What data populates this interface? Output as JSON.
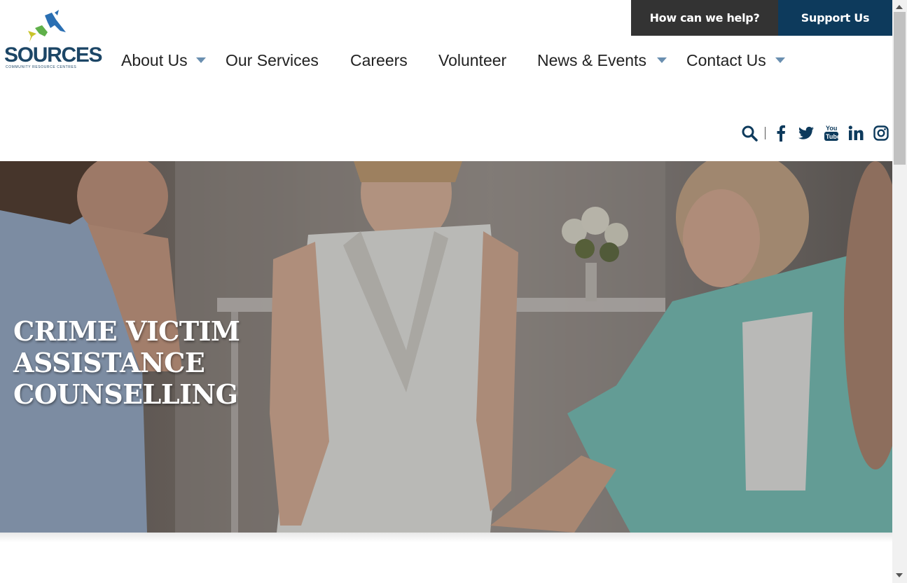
{
  "brand": {
    "name": "SOURCES",
    "tagline": "COMMUNITY RESOURCE CENTRES",
    "colors": {
      "navy": "#0d3a5c",
      "dark": "#333333",
      "caret": "#6a8fb0"
    }
  },
  "utility": {
    "help_label": "How can we help?",
    "support_label": "Support Us"
  },
  "nav": {
    "items": [
      {
        "label": "About Us",
        "has_dropdown": true
      },
      {
        "label": "Our Services",
        "has_dropdown": false
      },
      {
        "label": "Careers",
        "has_dropdown": false
      },
      {
        "label": "Volunteer",
        "has_dropdown": false
      },
      {
        "label": "News & Events",
        "has_dropdown": true
      },
      {
        "label": "Contact Us",
        "has_dropdown": true
      }
    ]
  },
  "social": {
    "icons": [
      "search-icon",
      "facebook-icon",
      "twitter-icon",
      "youtube-icon",
      "linkedin-icon",
      "instagram-icon"
    ]
  },
  "hero": {
    "title_line1": "CRIME VICTIM ASSISTANCE",
    "title_line2": "COUNSELLING"
  }
}
